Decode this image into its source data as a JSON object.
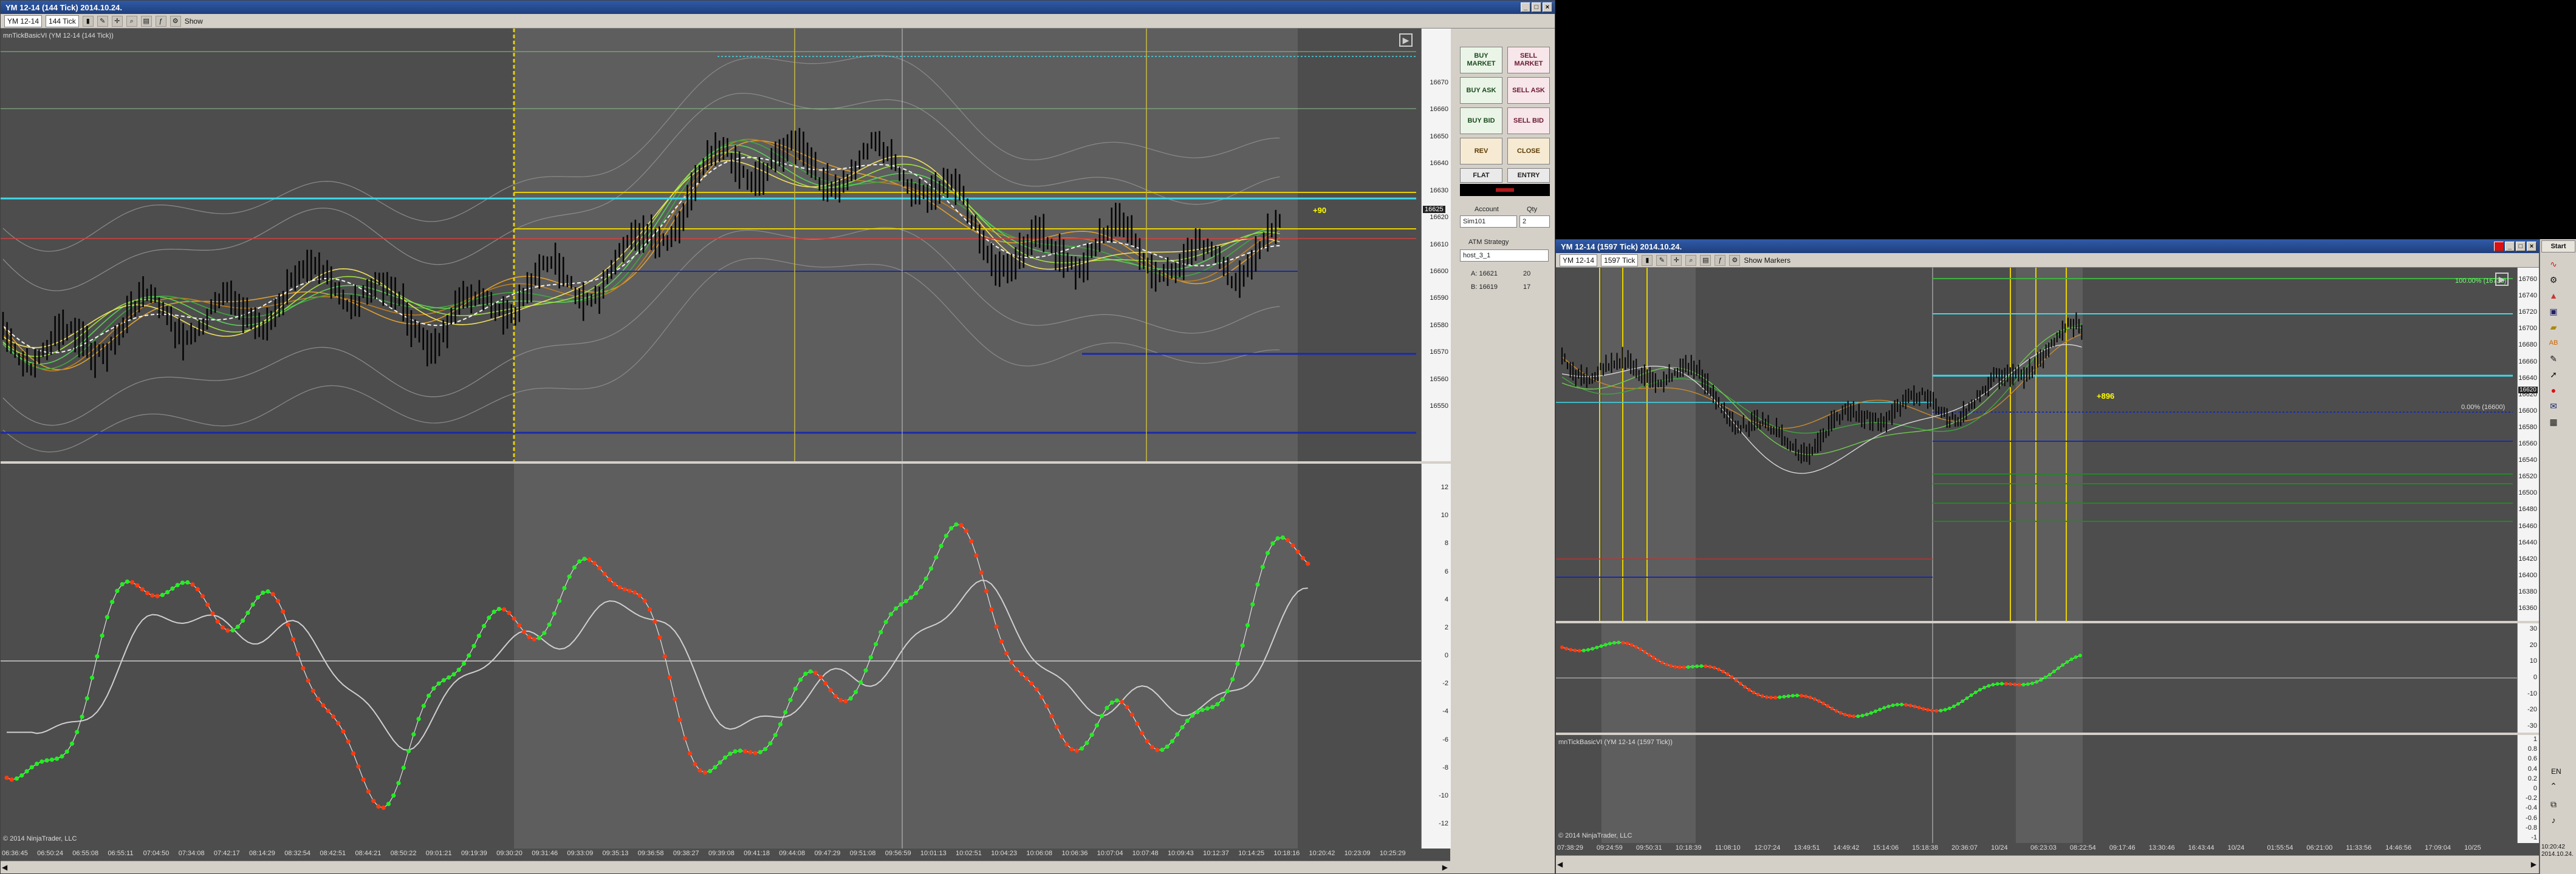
{
  "left_window": {
    "title": "YM 12-14 (144 Tick)  2014.10.24.",
    "instrument": "YM 12-14",
    "interval": "144 Tick",
    "show_label": "Show",
    "indicator_label": "mnTickBasicVI (YM 12-14 (144 Tick))",
    "copyright": "© 2014 NinjaTrader, LLC",
    "price_ticks": [
      "16670",
      "16660",
      "16650",
      "16640",
      "16630",
      "16620",
      "16610",
      "16600",
      "16590",
      "16580",
      "16570",
      "16560",
      "16550"
    ],
    "current_price": "16625",
    "position_tag": "+90",
    "osc_ticks": [
      "12",
      "10",
      "8",
      "6",
      "4",
      "2",
      "0",
      "-2",
      "-4",
      "-6",
      "-8",
      "-10",
      "-12"
    ],
    "time_labels": [
      "06:36:45",
      "06:50:24",
      "06:55:08",
      "06:55:11",
      "07:04:50",
      "07:34:08",
      "07:42:17",
      "08:14:29",
      "08:32:54",
      "08:42:51",
      "08:44:21",
      "08:50:22",
      "09:01:21",
      "09:19:39",
      "09:30:20",
      "09:31:46",
      "09:33:09",
      "09:35:13",
      "09:36:58",
      "09:38:27",
      "09:39:08",
      "09:41:18",
      "09:44:08",
      "09:47:29",
      "09:51:08",
      "09:56:59",
      "10:01:13",
      "10:02:51",
      "10:04:23",
      "10:06:08",
      "10:06:36",
      "10:07:04",
      "10:07:48",
      "10:09:43",
      "10:12:37",
      "10:14:25",
      "10:18:16",
      "10:20:42",
      "10:23:09",
      "10:25:29"
    ]
  },
  "order_panel": {
    "buy_market": "BUY\nMARKET",
    "sell_market": "SELL\nMARKET",
    "buy_ask": "BUY ASK",
    "sell_ask": "SELL ASK",
    "buy_bid": "BUY BID",
    "sell_bid": "SELL BID",
    "rev": "REV",
    "close": "CLOSE",
    "flat": "FLAT",
    "entry": "ENTRY",
    "account_label": "Account",
    "qty_label": "Qty",
    "account_value": "Sim101",
    "qty_value": "2",
    "atm_label": "ATM Strategy",
    "atm_value": "host_3_1",
    "ask_label": "A: 16621",
    "ask_size": "20",
    "bid_label": "B: 16619",
    "bid_size": "17"
  },
  "right_window": {
    "title": "YM 12-14 (1597 Tick)  2014.10.24.",
    "instrument": "YM 12-14",
    "interval": "1597 Tick",
    "show_markers": "Show Markers",
    "indicator_label": "mnTickBasicVI (YM 12-14 (1597 Tick))",
    "copyright": "© 2014 NinjaTrader, LLC",
    "price_ticks": [
      "16760",
      "16740",
      "16720",
      "16700",
      "16680",
      "16660",
      "16640",
      "16620",
      "16600",
      "16580",
      "16560",
      "16540",
      "16520",
      "16500",
      "16480",
      "16460",
      "16440",
      "16420",
      "16400",
      "16380",
      "16360"
    ],
    "current_price": "16620",
    "position_tag": "+896",
    "fib_100": "100.00% (16736)",
    "fib_0": "0.00% (16600)",
    "osc_ticks": [
      "30",
      "20",
      "10",
      "0",
      "-10",
      "-20",
      "-30"
    ],
    "osc2_ticks": [
      "1",
      "0.8",
      "0.6",
      "0.4",
      "0.2",
      "0",
      "-0.2",
      "-0.4",
      "-0.6",
      "-0.8",
      "-1"
    ],
    "time_labels": [
      "07:38:29",
      "09:24:59",
      "09:50:31",
      "10:18:39",
      "11:08:10",
      "12:07:24",
      "13:49:51",
      "14:49:42",
      "15:14:06",
      "15:18:38",
      "20:36:07",
      "10/24",
      "06:23:03",
      "08:22:54",
      "09:17:46",
      "13:30:46",
      "16:43:44",
      "10/24",
      "01:55:54",
      "06:21:00",
      "11:33:56",
      "14:46:56",
      "17:09:04",
      "10/25"
    ],
    "clock": "10:20:42\n2014.10.24."
  },
  "sidebar": {
    "start_label": "Start",
    "lang": "EN",
    "icons": [
      "excel-icon",
      "gear-icon",
      "chart-icon",
      "save-icon",
      "folder-icon",
      "abc-icon",
      "pencil-icon",
      "arrow-icon",
      "record-icon",
      "mail-icon",
      "grid-icon"
    ]
  },
  "colors": {
    "chart_bg": "#4d4d4d",
    "session_bg": "#5e5e5e",
    "yellow_line": "#e8d000",
    "cyan_line": "#40d8e8",
    "blue_line": "#1a2aa8",
    "green_dot": "#22ee22",
    "red_dot": "#ff3b10"
  }
}
